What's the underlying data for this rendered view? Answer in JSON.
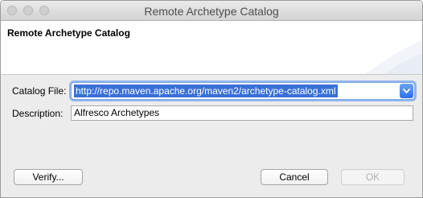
{
  "window": {
    "title": "Remote Archetype Catalog"
  },
  "banner": {
    "heading": "Remote Archetype Catalog"
  },
  "form": {
    "catalog_file_label": "Catalog File:",
    "catalog_file_value": "http://repo.maven.apache.org/maven2/archetype-catalog.xml",
    "description_label": "Description:",
    "description_value": "Alfresco Archetypes"
  },
  "buttons": {
    "verify": "Verify...",
    "cancel": "Cancel",
    "ok": "OK"
  },
  "icons": {
    "combo_arrow": "chevron-down-icon"
  },
  "colors": {
    "selection": "#3a6fd8",
    "focus_ring": "#8fb6f0"
  }
}
